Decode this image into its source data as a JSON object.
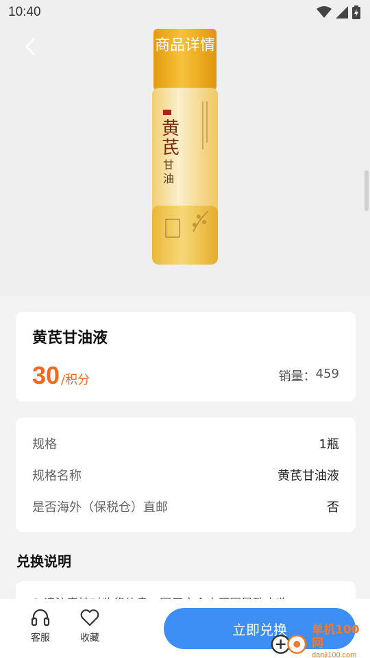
{
  "status_bar": {
    "time": "10:40"
  },
  "header": {
    "title": "商品详情"
  },
  "product": {
    "name": "黄芪甘油液",
    "price": "30",
    "price_unit": "/积分",
    "sales_label": "销量：",
    "sales_value": "459",
    "bottle_brand": "黄芪",
    "bottle_sub": "甘油"
  },
  "specs": [
    {
      "label": "规格",
      "value": "1瓶"
    },
    {
      "label": "规格名称",
      "value": "黄芪甘油液"
    },
    {
      "label": "是否海外（保税仓）直邮",
      "value": "否"
    }
  ],
  "exchange": {
    "title": "兑换说明",
    "text": "1.请注意核对收货信息，因用户个人原因导致未收"
  },
  "bottom_bar": {
    "service_label": "客服",
    "favorite_label": "收藏",
    "redeem_label": "立即兑换"
  },
  "watermark": {
    "name": "单机100网",
    "url": "danji100.com"
  },
  "colors": {
    "accent": "#f26a22",
    "button": "#3d8ef5",
    "background": "#f3f3f3"
  }
}
